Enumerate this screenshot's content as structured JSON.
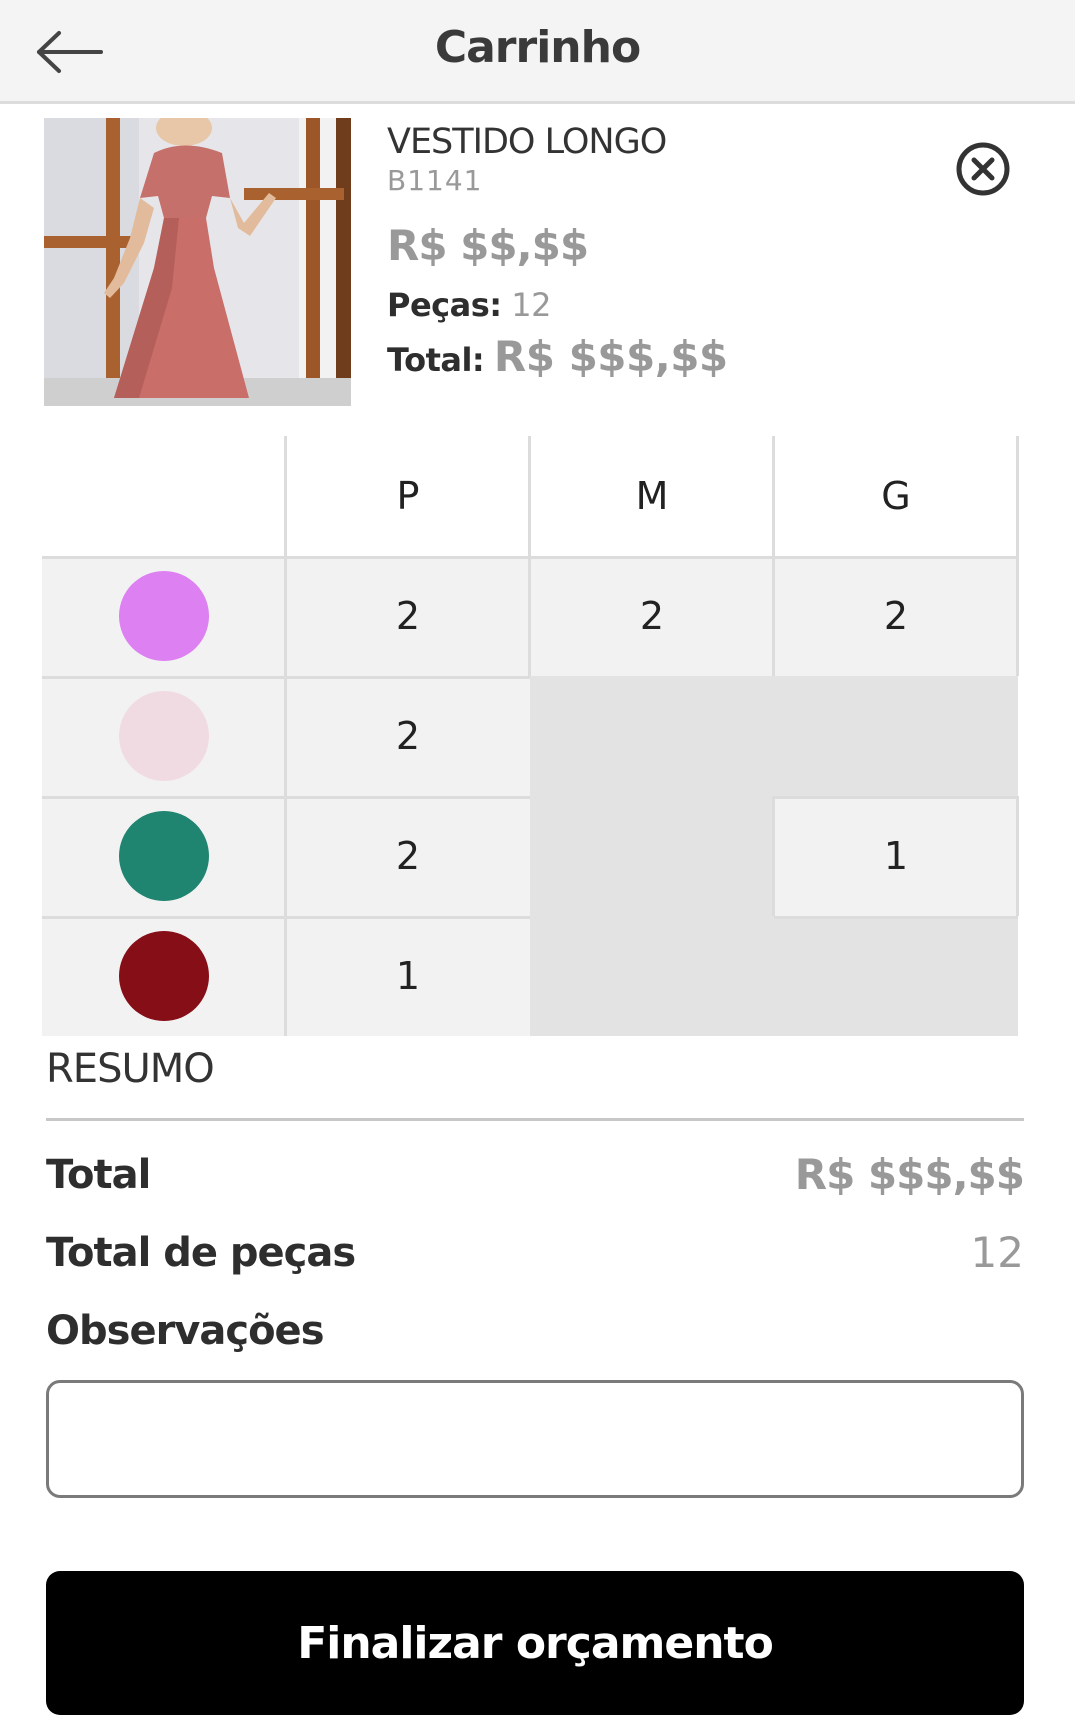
{
  "header": {
    "title": "Carrinho",
    "back_icon": "arrow-left-icon"
  },
  "product": {
    "name": "VESTIDO LONGO",
    "code": "B1141",
    "price": "R$ $$,$$",
    "pieces_label": "Peças:",
    "pieces_value": "12",
    "total_label": "Total:",
    "total_value": "R$ $$$,$$",
    "remove_icon": "close-circle-icon"
  },
  "grid": {
    "sizes": [
      "P",
      "M",
      "G"
    ],
    "rows": [
      {
        "color": "#dd80f2",
        "P": "2",
        "M": "2",
        "G": "2"
      },
      {
        "color": "#f1dbe3",
        "P": "2",
        "M": "",
        "G": ""
      },
      {
        "color": "#1f8470",
        "P": "2",
        "M": "",
        "G": "1"
      },
      {
        "color": "#860e17",
        "P": "1",
        "M": "",
        "G": ""
      }
    ]
  },
  "summary": {
    "title": "RESUMO",
    "total_label": "Total",
    "total_value": "R$ $$$,$$",
    "pieces_label": "Total de peças",
    "pieces_value": "12",
    "notes_label": "Observações",
    "notes_value": ""
  },
  "actions": {
    "finalize_label": "Finalizar orçamento"
  }
}
